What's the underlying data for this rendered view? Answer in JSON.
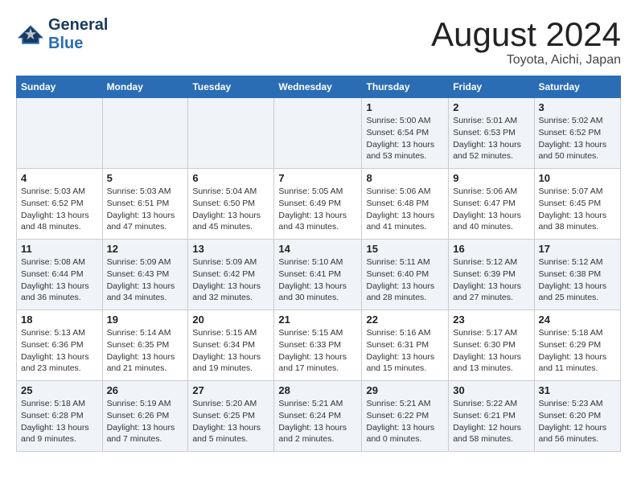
{
  "header": {
    "logo_line1": "General",
    "logo_line2": "Blue",
    "month_year": "August 2024",
    "location": "Toyota, Aichi, Japan"
  },
  "weekdays": [
    "Sunday",
    "Monday",
    "Tuesday",
    "Wednesday",
    "Thursday",
    "Friday",
    "Saturday"
  ],
  "weeks": [
    [
      {
        "day": "",
        "info": ""
      },
      {
        "day": "",
        "info": ""
      },
      {
        "day": "",
        "info": ""
      },
      {
        "day": "",
        "info": ""
      },
      {
        "day": "1",
        "info": "Sunrise: 5:00 AM\nSunset: 6:54 PM\nDaylight: 13 hours\nand 53 minutes."
      },
      {
        "day": "2",
        "info": "Sunrise: 5:01 AM\nSunset: 6:53 PM\nDaylight: 13 hours\nand 52 minutes."
      },
      {
        "day": "3",
        "info": "Sunrise: 5:02 AM\nSunset: 6:52 PM\nDaylight: 13 hours\nand 50 minutes."
      }
    ],
    [
      {
        "day": "4",
        "info": "Sunrise: 5:03 AM\nSunset: 6:52 PM\nDaylight: 13 hours\nand 48 minutes."
      },
      {
        "day": "5",
        "info": "Sunrise: 5:03 AM\nSunset: 6:51 PM\nDaylight: 13 hours\nand 47 minutes."
      },
      {
        "day": "6",
        "info": "Sunrise: 5:04 AM\nSunset: 6:50 PM\nDaylight: 13 hours\nand 45 minutes."
      },
      {
        "day": "7",
        "info": "Sunrise: 5:05 AM\nSunset: 6:49 PM\nDaylight: 13 hours\nand 43 minutes."
      },
      {
        "day": "8",
        "info": "Sunrise: 5:06 AM\nSunset: 6:48 PM\nDaylight: 13 hours\nand 41 minutes."
      },
      {
        "day": "9",
        "info": "Sunrise: 5:06 AM\nSunset: 6:47 PM\nDaylight: 13 hours\nand 40 minutes."
      },
      {
        "day": "10",
        "info": "Sunrise: 5:07 AM\nSunset: 6:45 PM\nDaylight: 13 hours\nand 38 minutes."
      }
    ],
    [
      {
        "day": "11",
        "info": "Sunrise: 5:08 AM\nSunset: 6:44 PM\nDaylight: 13 hours\nand 36 minutes."
      },
      {
        "day": "12",
        "info": "Sunrise: 5:09 AM\nSunset: 6:43 PM\nDaylight: 13 hours\nand 34 minutes."
      },
      {
        "day": "13",
        "info": "Sunrise: 5:09 AM\nSunset: 6:42 PM\nDaylight: 13 hours\nand 32 minutes."
      },
      {
        "day": "14",
        "info": "Sunrise: 5:10 AM\nSunset: 6:41 PM\nDaylight: 13 hours\nand 30 minutes."
      },
      {
        "day": "15",
        "info": "Sunrise: 5:11 AM\nSunset: 6:40 PM\nDaylight: 13 hours\nand 28 minutes."
      },
      {
        "day": "16",
        "info": "Sunrise: 5:12 AM\nSunset: 6:39 PM\nDaylight: 13 hours\nand 27 minutes."
      },
      {
        "day": "17",
        "info": "Sunrise: 5:12 AM\nSunset: 6:38 PM\nDaylight: 13 hours\nand 25 minutes."
      }
    ],
    [
      {
        "day": "18",
        "info": "Sunrise: 5:13 AM\nSunset: 6:36 PM\nDaylight: 13 hours\nand 23 minutes."
      },
      {
        "day": "19",
        "info": "Sunrise: 5:14 AM\nSunset: 6:35 PM\nDaylight: 13 hours\nand 21 minutes."
      },
      {
        "day": "20",
        "info": "Sunrise: 5:15 AM\nSunset: 6:34 PM\nDaylight: 13 hours\nand 19 minutes."
      },
      {
        "day": "21",
        "info": "Sunrise: 5:15 AM\nSunset: 6:33 PM\nDaylight: 13 hours\nand 17 minutes."
      },
      {
        "day": "22",
        "info": "Sunrise: 5:16 AM\nSunset: 6:31 PM\nDaylight: 13 hours\nand 15 minutes."
      },
      {
        "day": "23",
        "info": "Sunrise: 5:17 AM\nSunset: 6:30 PM\nDaylight: 13 hours\nand 13 minutes."
      },
      {
        "day": "24",
        "info": "Sunrise: 5:18 AM\nSunset: 6:29 PM\nDaylight: 13 hours\nand 11 minutes."
      }
    ],
    [
      {
        "day": "25",
        "info": "Sunrise: 5:18 AM\nSunset: 6:28 PM\nDaylight: 13 hours\nand 9 minutes."
      },
      {
        "day": "26",
        "info": "Sunrise: 5:19 AM\nSunset: 6:26 PM\nDaylight: 13 hours\nand 7 minutes."
      },
      {
        "day": "27",
        "info": "Sunrise: 5:20 AM\nSunset: 6:25 PM\nDaylight: 13 hours\nand 5 minutes."
      },
      {
        "day": "28",
        "info": "Sunrise: 5:21 AM\nSunset: 6:24 PM\nDaylight: 13 hours\nand 2 minutes."
      },
      {
        "day": "29",
        "info": "Sunrise: 5:21 AM\nSunset: 6:22 PM\nDaylight: 13 hours\nand 0 minutes."
      },
      {
        "day": "30",
        "info": "Sunrise: 5:22 AM\nSunset: 6:21 PM\nDaylight: 12 hours\nand 58 minutes."
      },
      {
        "day": "31",
        "info": "Sunrise: 5:23 AM\nSunset: 6:20 PM\nDaylight: 12 hours\nand 56 minutes."
      }
    ]
  ]
}
